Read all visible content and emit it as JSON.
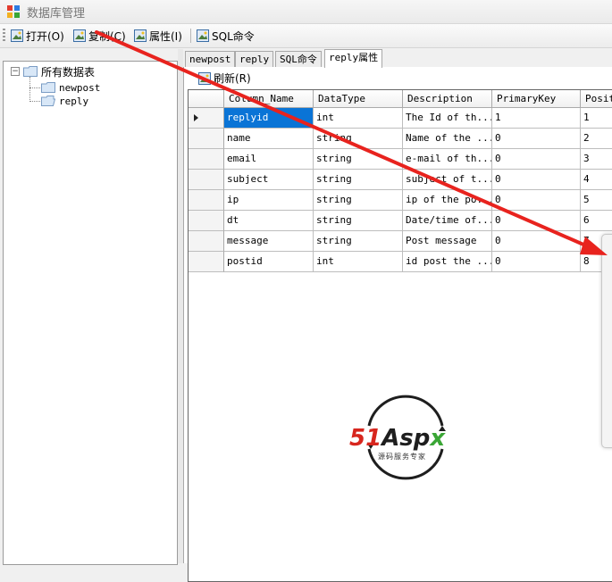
{
  "window": {
    "title": "数据库管理"
  },
  "toolbar": {
    "open_label": "打开(O)",
    "copy_label": "复制(C)",
    "properties_label": "属性(I)",
    "sql_label": "SQL命令"
  },
  "tree": {
    "root_label": "所有数据表",
    "expander_symbol": "−",
    "items": [
      {
        "label": "newpost"
      },
      {
        "label": "reply"
      }
    ]
  },
  "tabs": [
    {
      "label": "newpost"
    },
    {
      "label": "reply"
    },
    {
      "label": "SQL命令"
    },
    {
      "label": "reply属性"
    }
  ],
  "refresh_label": "刷新(R)",
  "grid": {
    "columns": [
      "Column_Name",
      "DataType",
      "Description",
      "PrimaryKey",
      "Posit"
    ],
    "rows": [
      [
        "replyid",
        "int",
        "The Id of th...",
        "1",
        "1"
      ],
      [
        "name",
        "string",
        "Name of the ...",
        "0",
        "2"
      ],
      [
        "email",
        "string",
        "e-mail of th...",
        "0",
        "3"
      ],
      [
        "subject",
        "string",
        "subject of t...",
        "0",
        "4"
      ],
      [
        "ip",
        "string",
        "ip of the po...",
        "0",
        "5"
      ],
      [
        "dt",
        "string",
        "Date/time of...",
        "0",
        "6"
      ],
      [
        "message",
        "string",
        "Post message",
        "0",
        "7"
      ],
      [
        "postid",
        "int",
        "id post the ...",
        "0",
        "8"
      ]
    ]
  },
  "watermark": {
    "brand": "51Aspx",
    "tagline": "源码服务专家"
  },
  "colors": {
    "selection": "#0a74d6",
    "arrow": "#e8231e",
    "logo_red": "#d7261e",
    "logo_green": "#3aa635"
  }
}
